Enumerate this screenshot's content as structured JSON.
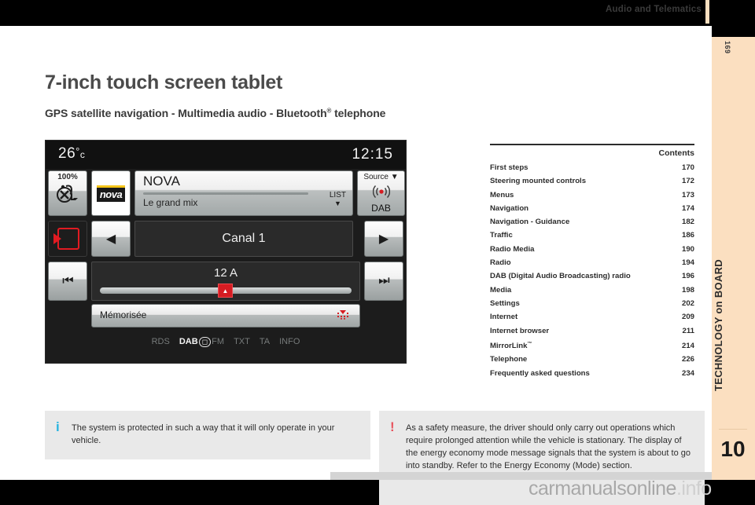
{
  "header": {
    "title": "Audio and Telematics",
    "accent_color": "#fbdfc0"
  },
  "side_tab": {
    "page_number": "169",
    "label": "TECHNOLOGY on BOARD",
    "chapter": "10"
  },
  "document": {
    "title": "7-inch touch screen tablet",
    "subtitle_parts": {
      "a": "GPS satellite navigation - Multimedia audio - Bluetooth",
      "sup": "®",
      "b": " telephone"
    }
  },
  "car_screen": {
    "status": {
      "temperature": "26",
      "degree": "°",
      "unit": "c",
      "clock": "12:15"
    },
    "mute_button": {
      "percent": "100%",
      "icon": "mute-music-icon"
    },
    "station_logo": "nova",
    "station": {
      "name": "NOVA",
      "subtitle": "Le grand mix",
      "list_label": "LIST",
      "list_caret": "▼"
    },
    "source": {
      "label": "Source",
      "caret": "▼",
      "name": "DAB",
      "icon": "radio-waves-icon"
    },
    "nav_left": "◀",
    "nav_right": "▶",
    "channel": "Canal 1",
    "skip_prev": "⏮",
    "skip_next": "⏭",
    "frequency": "12 A",
    "marker": "▲",
    "memorised": "Mémorisée",
    "memorised_icon": "signal-strength-icon",
    "footer_items": [
      "RDS",
      "TXT",
      "TA",
      "INFO"
    ],
    "footer_dab": {
      "dab": "DAB",
      "boxed": "▭",
      "fm": "FM"
    }
  },
  "contents": {
    "heading": "Contents",
    "rows": [
      {
        "label": "First steps",
        "page": "170"
      },
      {
        "label": "Steering mounted controls",
        "page": "172"
      },
      {
        "label": "Menus",
        "page": "173"
      },
      {
        "label": "Navigation",
        "page": "174"
      },
      {
        "label": "Navigation - Guidance",
        "page": "182"
      },
      {
        "label": "Traffic",
        "page": "186"
      },
      {
        "label": "Radio Media",
        "page": "190"
      },
      {
        "label": "Radio",
        "page": "194"
      },
      {
        "label": "DAB (Digital Audio Broadcasting) radio",
        "page": "196"
      },
      {
        "label": "Media",
        "page": "198"
      },
      {
        "label": "Settings",
        "page": "202"
      },
      {
        "label": "Internet",
        "page": "209"
      },
      {
        "label": "Internet browser",
        "page": "211"
      },
      {
        "label": "MirrorLink",
        "page": "214",
        "sup": "™"
      },
      {
        "label": "Telephone",
        "page": "226"
      },
      {
        "label": "Frequently asked questions",
        "page": "234"
      }
    ]
  },
  "notes": {
    "info": {
      "icon": "i",
      "text": "The system is protected in such a way that it will only operate in your vehicle."
    },
    "warning": {
      "icon": "!",
      "text": "As a safety measure, the driver should only carry out operations which require prolonged attention while the vehicle is stationary. The display of the energy economy mode message signals that the system is about to go into standby. Refer to the Energy Economy (Mode) section."
    }
  },
  "watermark": {
    "name": "carmanualsonline",
    "tld": ".info"
  }
}
